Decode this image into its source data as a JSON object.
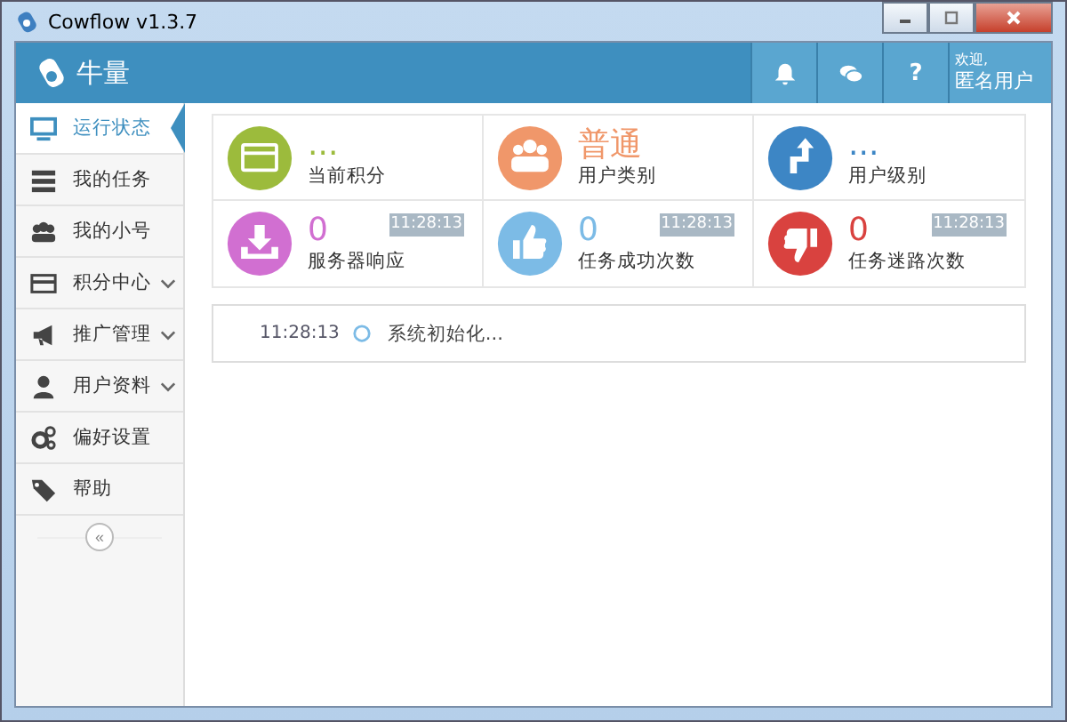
{
  "window": {
    "title": "Cowflow v1.3.7"
  },
  "header": {
    "app_name": "牛量",
    "welcome": "欢迎,",
    "user": "匿名用户",
    "help": "?"
  },
  "sidebar": {
    "items": [
      {
        "label": "运行状态",
        "selected": true,
        "expandable": false
      },
      {
        "label": "我的任务",
        "selected": false,
        "expandable": false
      },
      {
        "label": "我的小号",
        "selected": false,
        "expandable": false
      },
      {
        "label": "积分中心",
        "selected": false,
        "expandable": true
      },
      {
        "label": "推广管理",
        "selected": false,
        "expandable": true
      },
      {
        "label": "用户资料",
        "selected": false,
        "expandable": true
      },
      {
        "label": "偏好设置",
        "selected": false,
        "expandable": false
      },
      {
        "label": "帮助",
        "selected": false,
        "expandable": false
      }
    ],
    "collapse": "«"
  },
  "stats": [
    {
      "value": "...",
      "label": "当前积分",
      "color": "#9cbb3c"
    },
    {
      "value": "普通",
      "label": "用户类别",
      "color": "#f0976a"
    },
    {
      "value": "...",
      "label": "用户级别",
      "color": "#3d86c5"
    },
    {
      "value": "0",
      "label": "服务器响应",
      "color": "#d16fd1",
      "time": "11:28:13"
    },
    {
      "value": "0",
      "label": "任务成功次数",
      "color": "#7cbbe6",
      "time": "11:28:13"
    },
    {
      "value": "0",
      "label": "任务迷路次数",
      "color": "#d9423f",
      "time": "11:28:13"
    }
  ],
  "log": [
    {
      "time": "11:28:13",
      "message": "系统初始化..."
    }
  ]
}
